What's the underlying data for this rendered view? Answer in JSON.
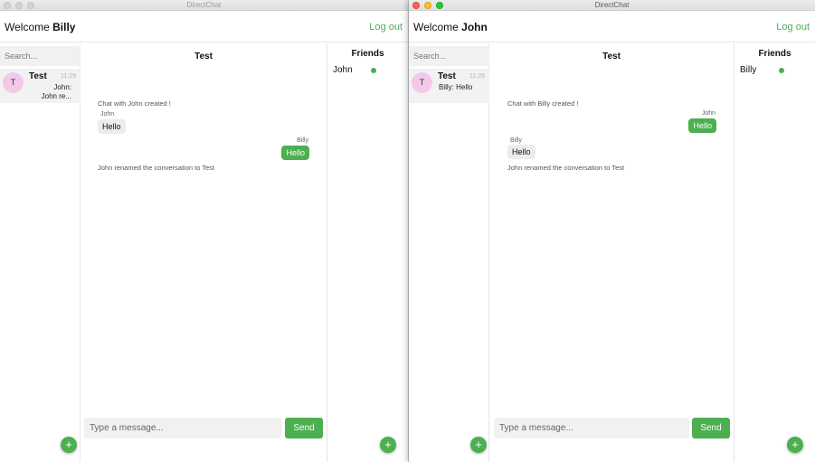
{
  "windows": [
    {
      "title": "DirectChat",
      "welcome_prefix": "Welcome",
      "username": "Billy",
      "logout": "Log out",
      "search_placeholder": "Search...",
      "conversation": {
        "avatar": "T",
        "name": "Test",
        "time": "11:29",
        "preview_line1": "John:",
        "preview_line2": "John re..."
      },
      "chat_title": "Test",
      "messages": {
        "created": "Chat with John created !",
        "m1_sender": "John",
        "m1_text": "Hello",
        "m2_sender": "Billy",
        "m2_text": "Hello",
        "renamed": "John renamed the conversation to Test"
      },
      "message_placeholder": "Type a message...",
      "send": "Send",
      "friends_title": "Friends",
      "friends": [
        {
          "name": "John",
          "online": true
        }
      ],
      "add_label": "+"
    },
    {
      "title": "DirectChat",
      "welcome_prefix": "Welcome",
      "username": "John",
      "logout": "Log out",
      "search_placeholder": "Search...",
      "conversation": {
        "avatar": "T",
        "name": "Test",
        "time": "11:28",
        "preview": "Billy:  Hello"
      },
      "chat_title": "Test",
      "messages": {
        "created": "Chat with Billy created !",
        "m1_sender": "John",
        "m1_text": "Hello",
        "m2_sender": "Billy",
        "m2_text": "Hello",
        "renamed": "John renamed the conversation to Test"
      },
      "message_placeholder": "Type a message...",
      "send": "Send",
      "friends_title": "Friends",
      "friends": [
        {
          "name": "Billy",
          "online": true
        }
      ],
      "add_label": "+"
    }
  ],
  "colors": {
    "accent": "#4caf50",
    "avatar": "#f5c8ea"
  }
}
